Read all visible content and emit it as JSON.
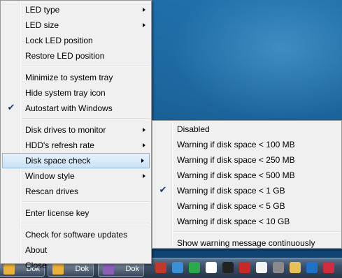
{
  "main_menu": {
    "groups": [
      [
        {
          "label": "LED type",
          "submenu": true
        },
        {
          "label": "LED size",
          "submenu": true
        },
        {
          "label": "Lock LED position"
        },
        {
          "label": "Restore LED position"
        }
      ],
      [
        {
          "label": "Minimize to system tray"
        },
        {
          "label": "Hide system tray icon"
        },
        {
          "label": "Autostart with Windows",
          "checked": true
        }
      ],
      [
        {
          "label": "Disk drives to monitor",
          "submenu": true
        },
        {
          "label": "HDD's refresh rate",
          "submenu": true
        },
        {
          "label": "Disk space check",
          "submenu": true,
          "highlighted": true
        },
        {
          "label": "Window style",
          "submenu": true
        },
        {
          "label": "Rescan drives"
        }
      ],
      [
        {
          "label": "Enter license key"
        }
      ],
      [
        {
          "label": "Check for software updates"
        },
        {
          "label": "About"
        },
        {
          "label": "Close"
        }
      ]
    ]
  },
  "submenu": {
    "groups": [
      [
        {
          "label": "Disabled"
        },
        {
          "label": "Warning if disk space < 100 MB"
        },
        {
          "label": "Warning if disk space < 250 MB"
        },
        {
          "label": "Warning if disk space < 500 MB"
        },
        {
          "label": "Warning if disk space < 1 GB",
          "checked": true
        },
        {
          "label": "Warning if disk space < 5 GB"
        },
        {
          "label": "Warning if disk space < 10 GB"
        }
      ],
      [
        {
          "label": "Show warning message continuously"
        }
      ]
    ]
  },
  "taskbar": {
    "buttons": [
      "Dok",
      "Dok",
      "Dok"
    ],
    "tray_icons": [
      {
        "name": "eject-icon",
        "color": "#c0392b"
      },
      {
        "name": "globe-icon",
        "color": "#3a8fd6"
      },
      {
        "name": "download-arrow-icon",
        "color": "#2aa84a"
      },
      {
        "name": "pen-icon",
        "color": "#ffffff"
      },
      {
        "name": "camera-icon",
        "color": "#222222"
      },
      {
        "name": "keyboard-icon",
        "color": "#c82828"
      },
      {
        "name": "blank-window-icon",
        "color": "#f4f4f4"
      },
      {
        "name": "drive-icon",
        "color": "#8a8a8a"
      },
      {
        "name": "clipboard-icon",
        "color": "#e8c058"
      },
      {
        "name": "teamviewer-icon",
        "color": "#1e73c8"
      },
      {
        "name": "shield-icon",
        "color": "#d12c3c"
      }
    ]
  }
}
